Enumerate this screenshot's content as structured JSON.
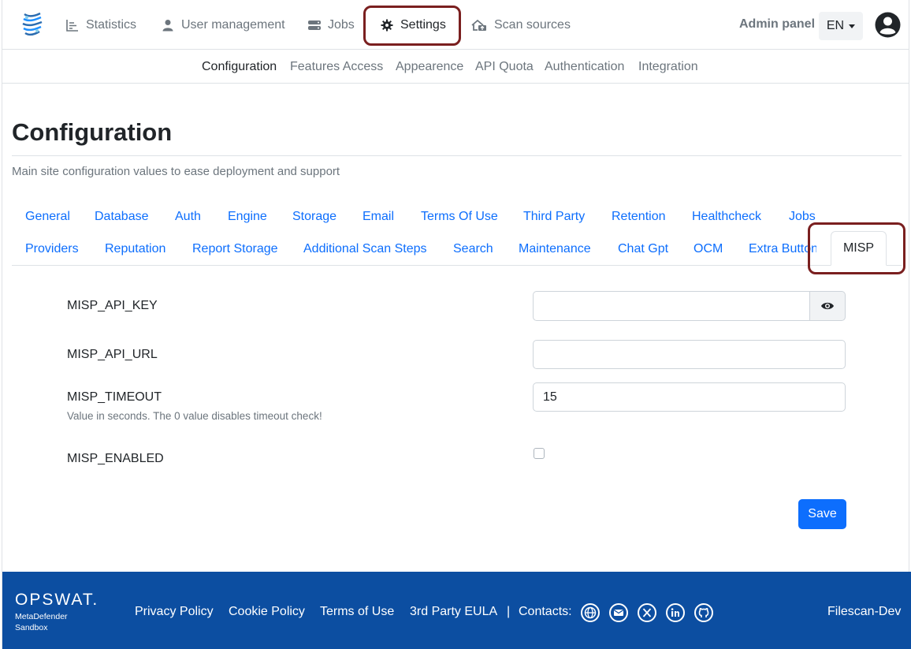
{
  "nav": {
    "items": [
      {
        "label": "Statistics",
        "icon": "chart-icon"
      },
      {
        "label": "User management",
        "icon": "user-icon"
      },
      {
        "label": "Jobs",
        "icon": "server-icon"
      },
      {
        "label": "Settings",
        "icon": "gear-icon",
        "active": true
      },
      {
        "label": "Scan sources",
        "icon": "house-upload-icon"
      }
    ],
    "admin_label": "Admin panel",
    "language": "EN"
  },
  "subnav": {
    "items": [
      "Configuration",
      "Features Access",
      "Appearence",
      "API Quota",
      "Authentication",
      "Integration"
    ],
    "active": "Configuration"
  },
  "page": {
    "title": "Configuration",
    "subtitle": "Main site configuration values to ease deployment and support"
  },
  "tabs": {
    "row1": [
      "General",
      "Database",
      "Auth",
      "Engine",
      "Storage",
      "Email",
      "Terms Of Use",
      "Third Party",
      "Retention",
      "Healthcheck",
      "Jobs"
    ],
    "row2": [
      "Providers",
      "Reputation",
      "Report Storage",
      "Additional Scan Steps",
      "Search",
      "Maintenance",
      "Chat Gpt",
      "OCM",
      "Extra Button"
    ],
    "active": "MISP"
  },
  "form": {
    "api_key_label": "MISP_API_KEY",
    "api_key_value": "",
    "api_url_label": "MISP_API_URL",
    "api_url_value": "",
    "timeout_label": "MISP_TIMEOUT",
    "timeout_value": "15",
    "timeout_help": "Value in seconds. The 0 value disables timeout check!",
    "enabled_label": "MISP_ENABLED",
    "enabled_value": false,
    "save_label": "Save"
  },
  "footer": {
    "brand": "OPSWAT.",
    "brand_sub1": "MetaDefender",
    "brand_sub2": "Sandbox",
    "links": [
      "Privacy Policy",
      "Cookie Policy",
      "Terms of Use",
      "3rd Party EULA"
    ],
    "separator": "|",
    "contacts_label": "Contacts:",
    "contact_icons": [
      "globe-icon",
      "mail-icon",
      "x-icon",
      "linkedin-icon",
      "github-icon"
    ],
    "env_label": "Filescan-Dev"
  },
  "colors": {
    "link": "#0d6efd",
    "footer_bg": "#0c4ea1",
    "highlight": "#7a1f1f",
    "save_bg": "#0d6efd"
  }
}
